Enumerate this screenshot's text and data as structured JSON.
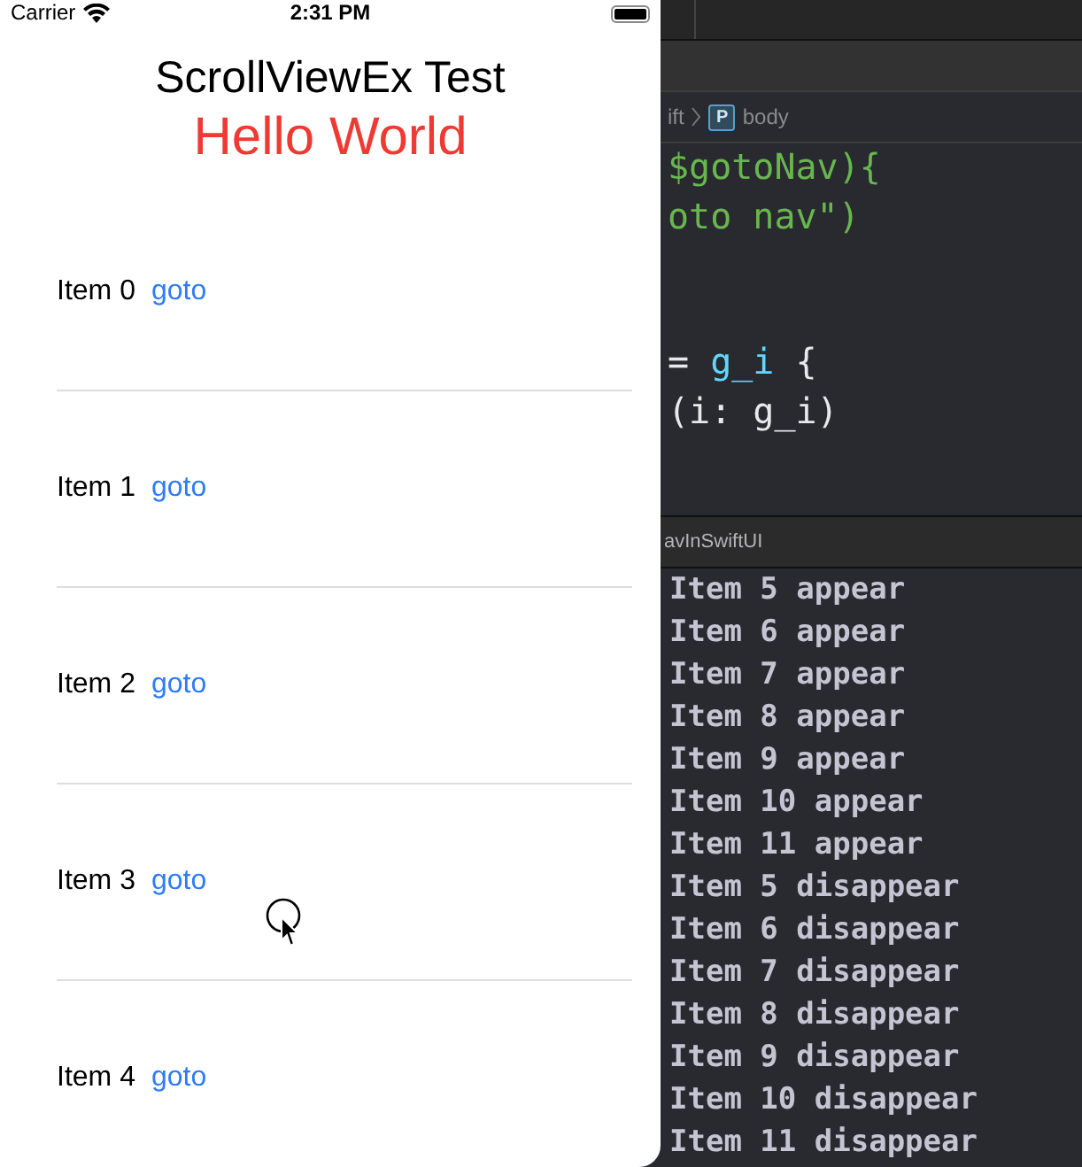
{
  "status_bar": {
    "carrier": "Carrier",
    "time": "2:31 PM"
  },
  "screen": {
    "title": "ScrollViewEx Test",
    "subtitle": "Hello World",
    "items": [
      {
        "label": "Item 0",
        "link": "goto"
      },
      {
        "label": "Item 1",
        "link": "goto"
      },
      {
        "label": "Item 2",
        "link": "goto"
      },
      {
        "label": "Item 3",
        "link": "goto"
      },
      {
        "label": "Item 4",
        "link": "goto"
      }
    ]
  },
  "editor": {
    "breadcrumb": {
      "file": "ift",
      "badge": "P",
      "symbol": "body"
    },
    "code_blocks": [
      [
        [
          {
            "text": "$gotoNav){",
            "kind": "string"
          }
        ],
        [
          {
            "text": "oto nav\")",
            "kind": "string"
          }
        ]
      ],
      [
        [
          {
            "text": "= ",
            "kind": "plain"
          },
          {
            "text": "g_i",
            "kind": "type"
          },
          {
            "text": " {",
            "kind": "plain"
          }
        ],
        [
          {
            "text": "(i: g_i)",
            "kind": "plain"
          }
        ]
      ]
    ]
  },
  "debug_bar": {
    "title": "avInSwiftUI"
  },
  "console": [
    "Item 5 appear",
    "Item 6 appear",
    "Item 7 appear",
    "Item 8 appear",
    "Item 9 appear",
    "Item 10 appear",
    "Item 11 appear",
    "Item 5 disappear",
    "Item 6 disappear",
    "Item 7 disappear",
    "Item 8 disappear",
    "Item 9 disappear",
    "Item 10 disappear",
    "Item 11 disappear"
  ]
}
